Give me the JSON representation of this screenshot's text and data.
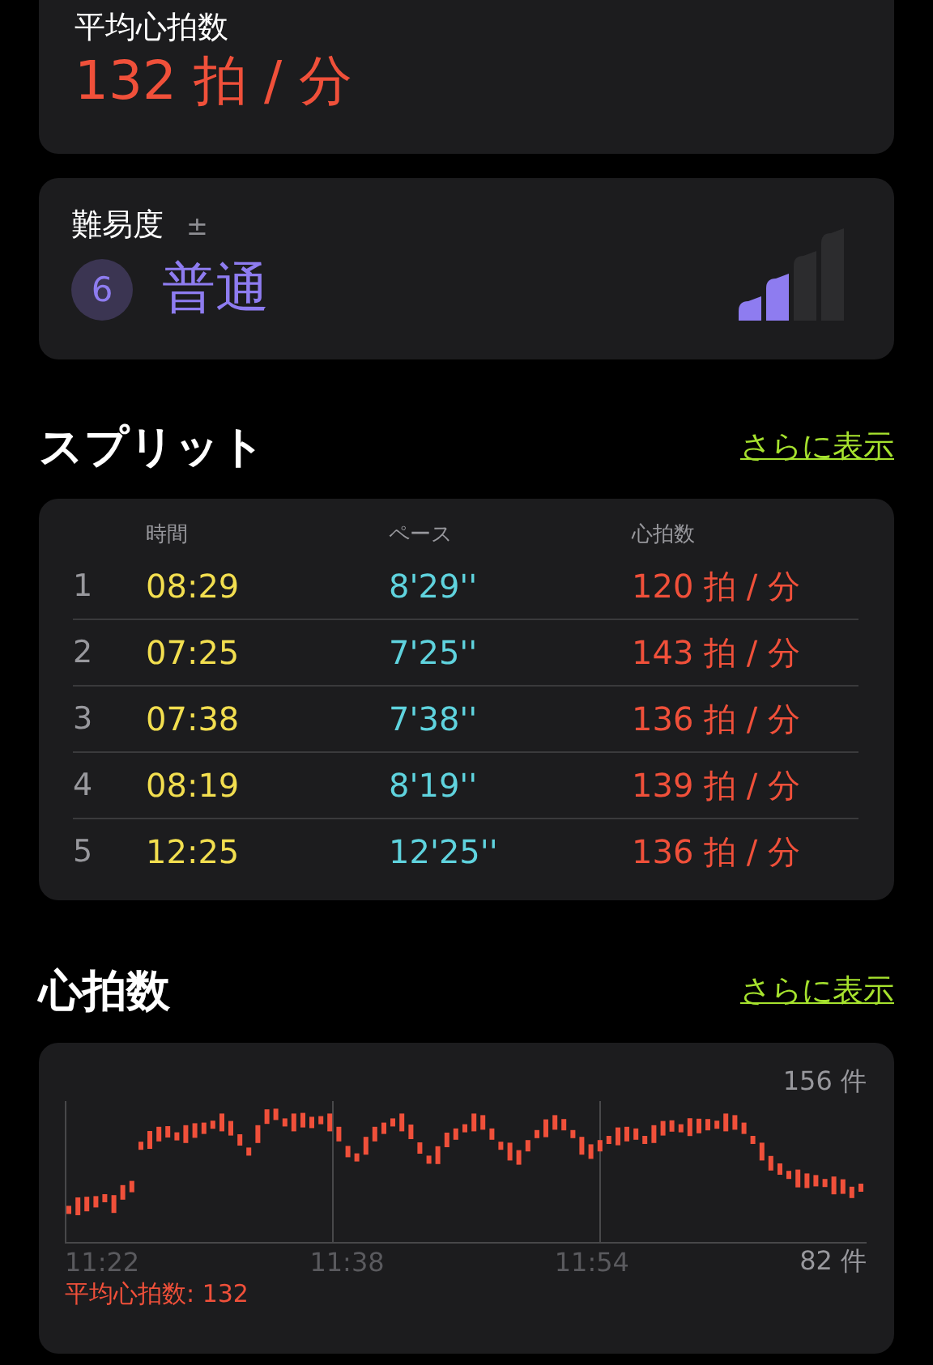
{
  "summary": {
    "label": "平均心拍数",
    "value": "132 拍 / 分"
  },
  "difficulty": {
    "label": "難易度",
    "adjust_icon": "±",
    "score": "6",
    "rating": "普通",
    "level": 0.5
  },
  "splits": {
    "title": "スプリット",
    "more": "さらに表示",
    "columns": [
      "時間",
      "ペース",
      "心拍数"
    ],
    "rows": [
      {
        "index": "1",
        "time": "08:29",
        "pace": "8'29''",
        "heart_rate": "120 拍 / 分"
      },
      {
        "index": "2",
        "time": "07:25",
        "pace": "7'25''",
        "heart_rate": "143 拍 / 分"
      },
      {
        "index": "3",
        "time": "07:38",
        "pace": "7'38''",
        "heart_rate": "136 拍 / 分"
      },
      {
        "index": "4",
        "time": "08:19",
        "pace": "8'19''",
        "heart_rate": "139 拍 / 分"
      },
      {
        "index": "5",
        "time": "12:25",
        "pace": "12'25''",
        "heart_rate": "136 拍 / 分"
      }
    ]
  },
  "heart_rate": {
    "title": "心拍数",
    "more": "さらに表示",
    "max_label": "156 件",
    "min_label": "82 件",
    "times": [
      "11:22",
      "11:38",
      "11:54"
    ],
    "average": "平均心拍数: 132"
  }
}
